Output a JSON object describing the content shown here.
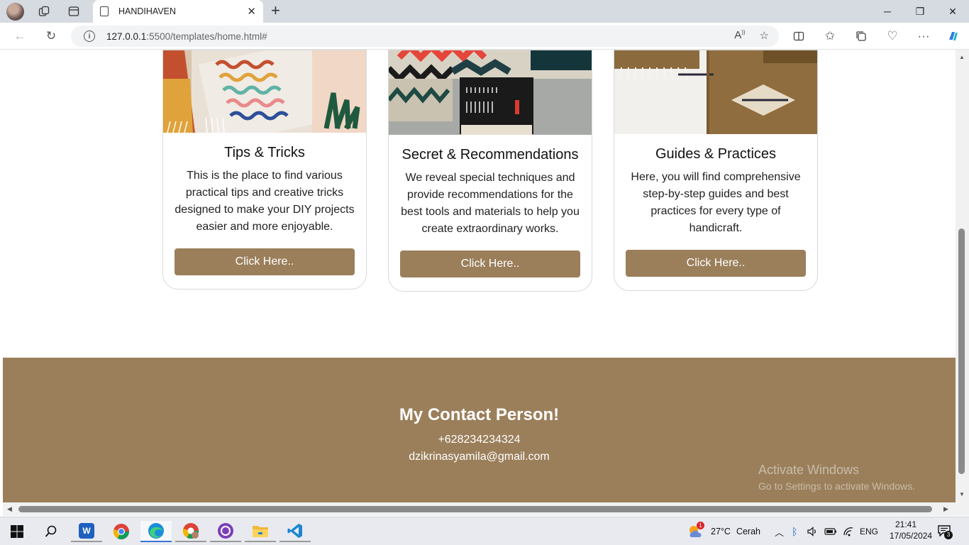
{
  "browser": {
    "tab_title": "HANDIHAVEN",
    "url_host": "127.0.0.1",
    "url_rest": ":5500/templates/home.html#"
  },
  "cards": [
    {
      "title": "Tips & Tricks",
      "text": "This is the place to find various practical tips and creative tricks designed to make your DIY projects easier and more enjoyable.",
      "button": "Click Here.."
    },
    {
      "title": "Secret & Recommendations",
      "text": "We reveal special techniques and provide recommendations for the best tools and materials to help you create extraordinary works.",
      "button": "Click Here.."
    },
    {
      "title": "Guides & Practices",
      "text": "Here, you will find comprehensive step-by-step guides and best practices for every type of handicraft.",
      "button": "Click Here.."
    }
  ],
  "footer": {
    "heading": "My Contact Person!",
    "phone": "+628234234324",
    "email": "dzikrinasyamila@gmail.com"
  },
  "watermark": {
    "line1": "Activate Windows",
    "line2": "Go to Settings to activate Windows."
  },
  "taskbar": {
    "weather_temp": "27°C",
    "weather_text": "Cerah",
    "weather_badge": "1",
    "language": "ENG",
    "time": "21:41",
    "date": "17/05/2024",
    "notification_count": "3",
    "word_letter": "W"
  },
  "colors": {
    "accent": "#9b7f5b",
    "footer_bg": "#9b7f5b"
  }
}
